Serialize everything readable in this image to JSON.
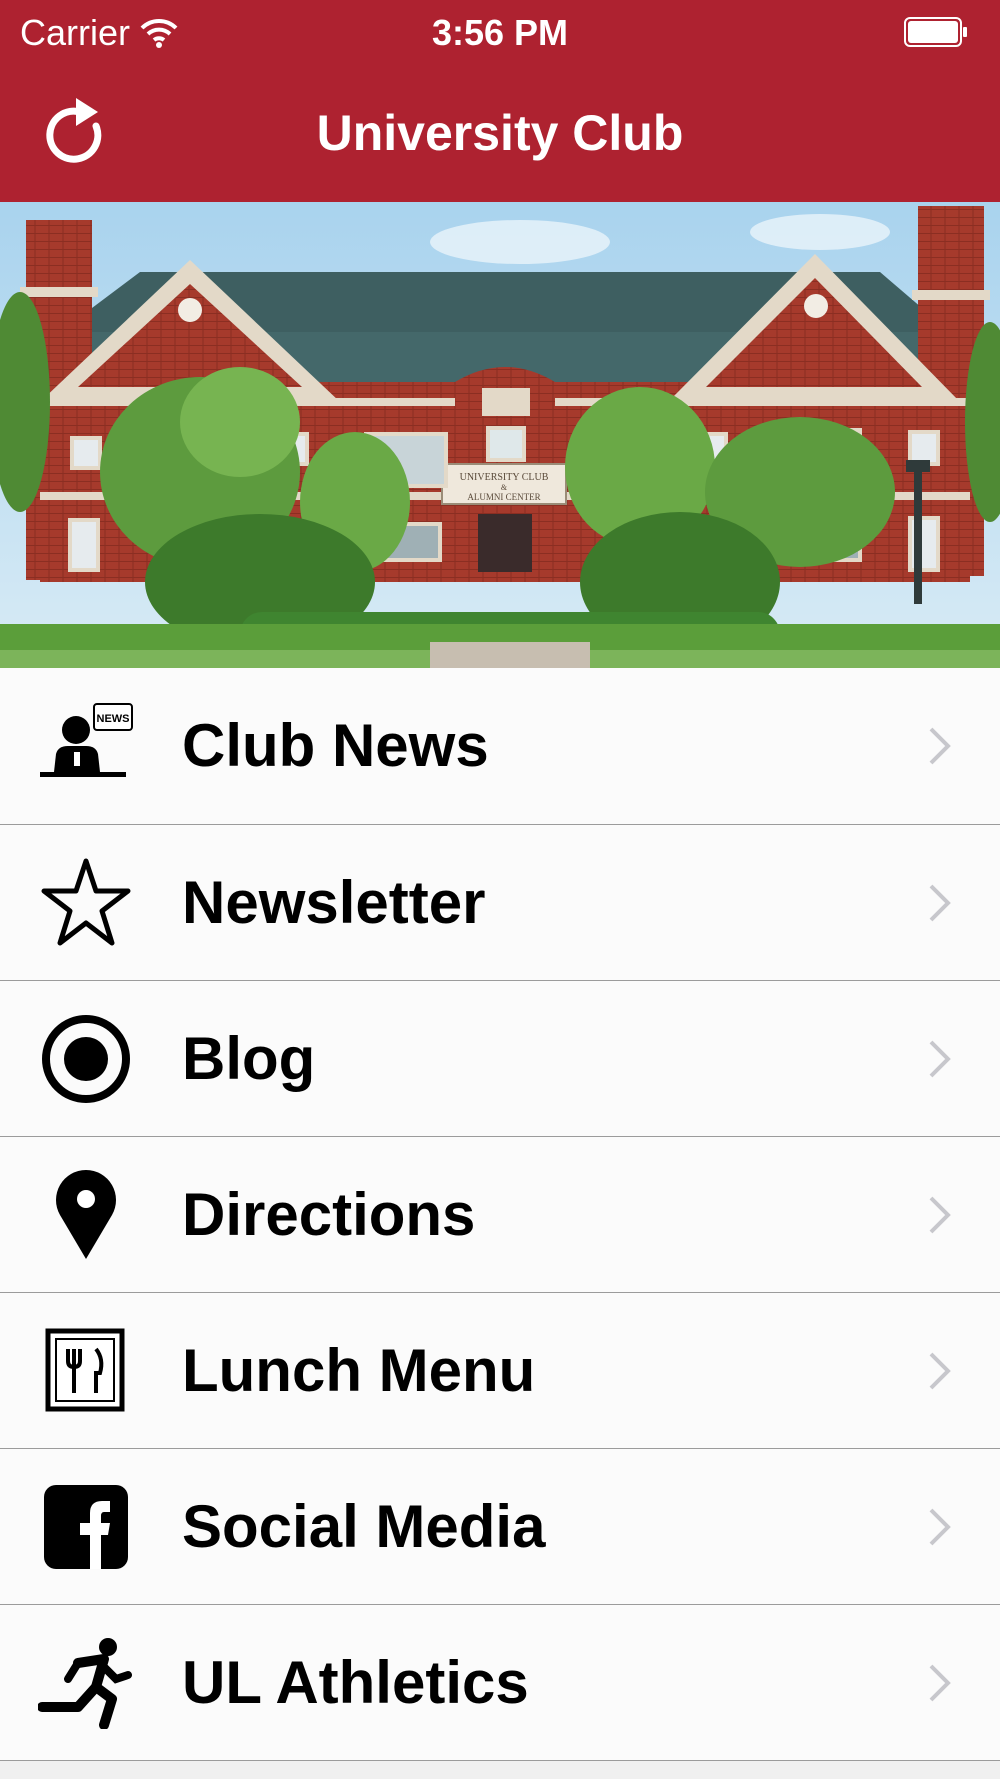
{
  "status_bar": {
    "carrier": "Carrier",
    "time": "3:56 PM"
  },
  "nav": {
    "title": "University Club",
    "refresh_icon": "refresh-icon"
  },
  "hero": {
    "sign_line1": "UNIVERSITY CLUB",
    "sign_line2": "&",
    "sign_line3": "ALUMNI CENTER"
  },
  "menu": [
    {
      "label": "Club News",
      "icon": "news-icon"
    },
    {
      "label": "Newsletter",
      "icon": "star-icon"
    },
    {
      "label": "Blog",
      "icon": "record-icon"
    },
    {
      "label": "Directions",
      "icon": "map-pin-icon"
    },
    {
      "label": "Lunch Menu",
      "icon": "fork-knife-icon"
    },
    {
      "label": "Social Media",
      "icon": "facebook-icon"
    },
    {
      "label": "UL Athletics",
      "icon": "running-man-icon"
    }
  ],
  "colors": {
    "accent": "#ae2230",
    "chevron": "#c7c7cc"
  }
}
